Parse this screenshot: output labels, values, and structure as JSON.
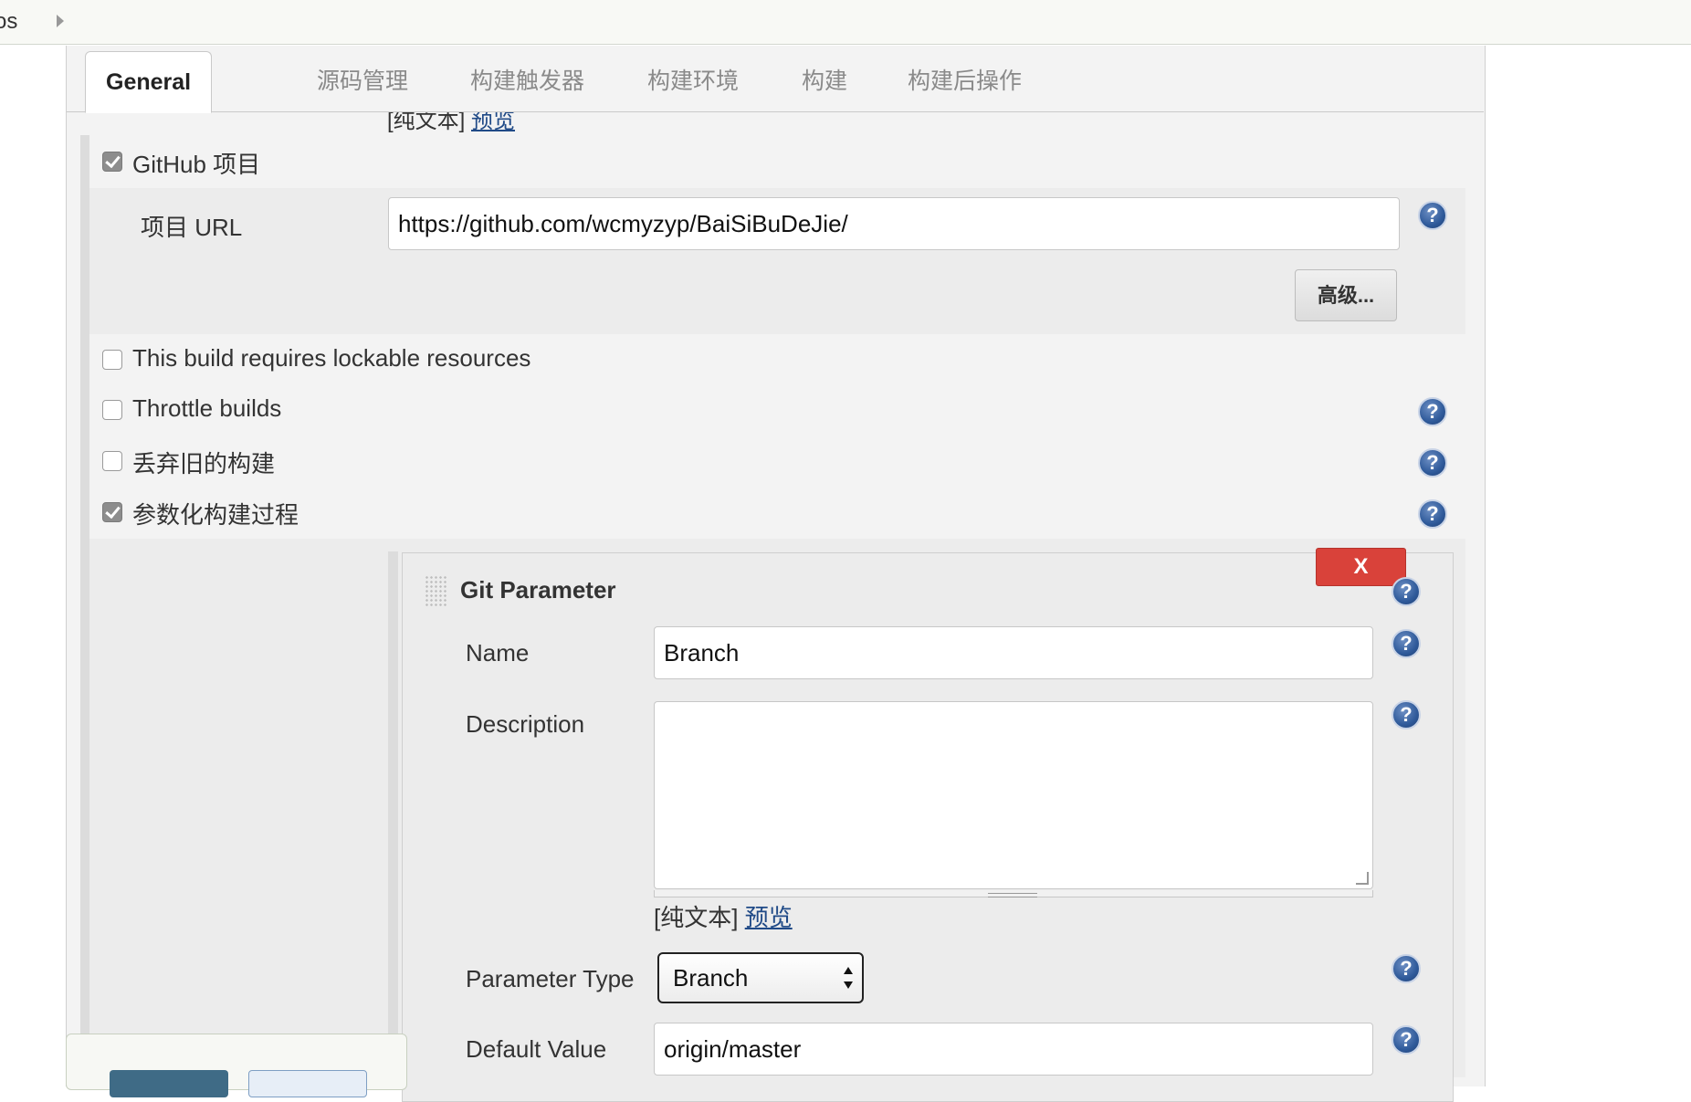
{
  "breadcrumb": {
    "text": "os"
  },
  "tabs": [
    {
      "label": "General",
      "active": true
    },
    {
      "label": "源码管理",
      "active": false
    },
    {
      "label": "构建触发器",
      "active": false
    },
    {
      "label": "构建环境",
      "active": false
    },
    {
      "label": "构建",
      "active": false
    },
    {
      "label": "构建后操作",
      "active": false
    }
  ],
  "cut_off": {
    "plain_text": "[纯文本]",
    "preview_link": "预览"
  },
  "github_project": {
    "label": "GitHub 项目",
    "checked": true,
    "url_label": "项目 URL",
    "url_value": "https://github.com/wcmyzyp/BaiSiBuDeJie/",
    "advanced_button": "高级..."
  },
  "options": [
    {
      "label": "This build requires lockable resources",
      "checked": false
    },
    {
      "label": "Throttle builds",
      "checked": false
    },
    {
      "label": "丢弃旧的构建",
      "checked": false
    },
    {
      "label": "参数化构建过程",
      "checked": true
    }
  ],
  "git_parameter": {
    "title": "Git Parameter",
    "delete_button": "X",
    "name_label": "Name",
    "name_value": "Branch",
    "description_label": "Description",
    "description_value": "",
    "plain_text": "[纯文本]",
    "preview_link": "预览",
    "parameter_type_label": "Parameter Type",
    "parameter_type_value": "Branch",
    "default_value_label": "Default Value",
    "default_value": "origin/master"
  },
  "help_icon": "?",
  "colors": {
    "delete_button": "#d9423a",
    "help_icon": "#2f5a9a",
    "link": "#204a87"
  }
}
